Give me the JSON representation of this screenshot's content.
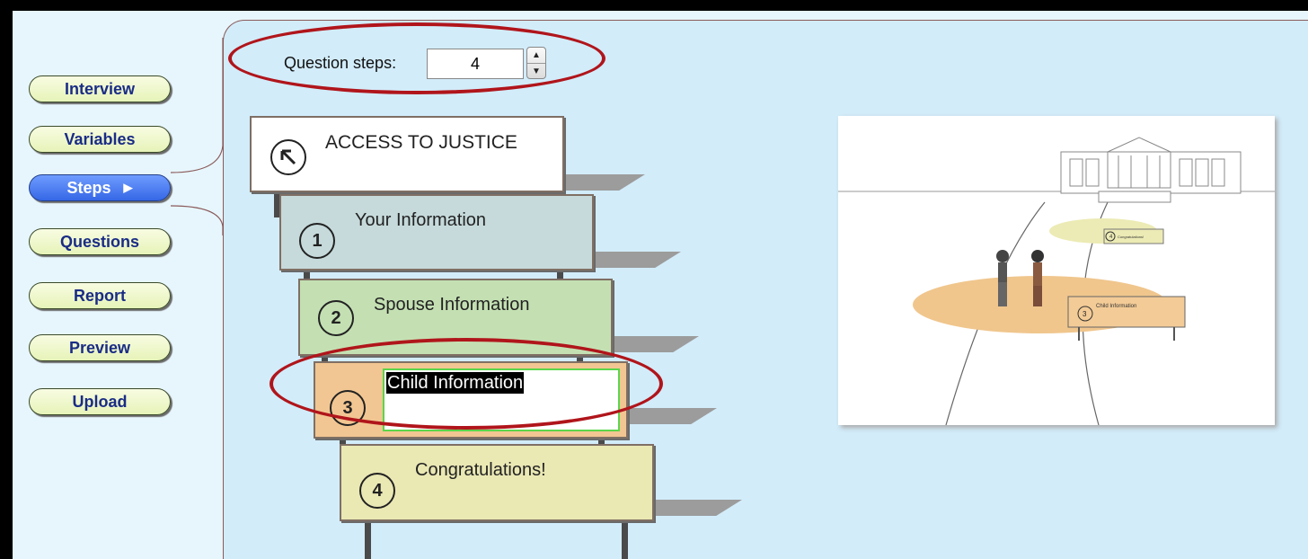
{
  "nav": [
    {
      "label": "Interview",
      "active": false
    },
    {
      "label": "Variables",
      "active": false
    },
    {
      "label": "Steps",
      "active": true
    },
    {
      "label": "Questions",
      "active": false
    },
    {
      "label": "Report",
      "active": false
    },
    {
      "label": "Preview",
      "active": false
    },
    {
      "label": "Upload",
      "active": false
    }
  ],
  "question_steps": {
    "label": "Question steps:",
    "value": "4"
  },
  "signs": {
    "start": {
      "icon": "arrow-up-left-icon",
      "title": "ACCESS TO JUSTICE"
    },
    "steps": [
      {
        "number": "1",
        "title": "Your Information",
        "color": "#c6dadb"
      },
      {
        "number": "2",
        "title": "Spouse Information",
        "color": "#c4e0b3"
      },
      {
        "number": "3",
        "title": "Child Information",
        "color": "#f2c692"
      },
      {
        "number": "4",
        "title": "Congratulations!",
        "color": "#eae8b3"
      }
    ]
  },
  "preview": {
    "sign_far": {
      "number": "4",
      "title": "Congratulations!"
    },
    "sign_near": {
      "number": "3",
      "title": "Child Information"
    }
  },
  "colors": {
    "annotation": "#b0151b",
    "active_nav": "#3567e6",
    "panel_bg": "#d2ecfa"
  }
}
